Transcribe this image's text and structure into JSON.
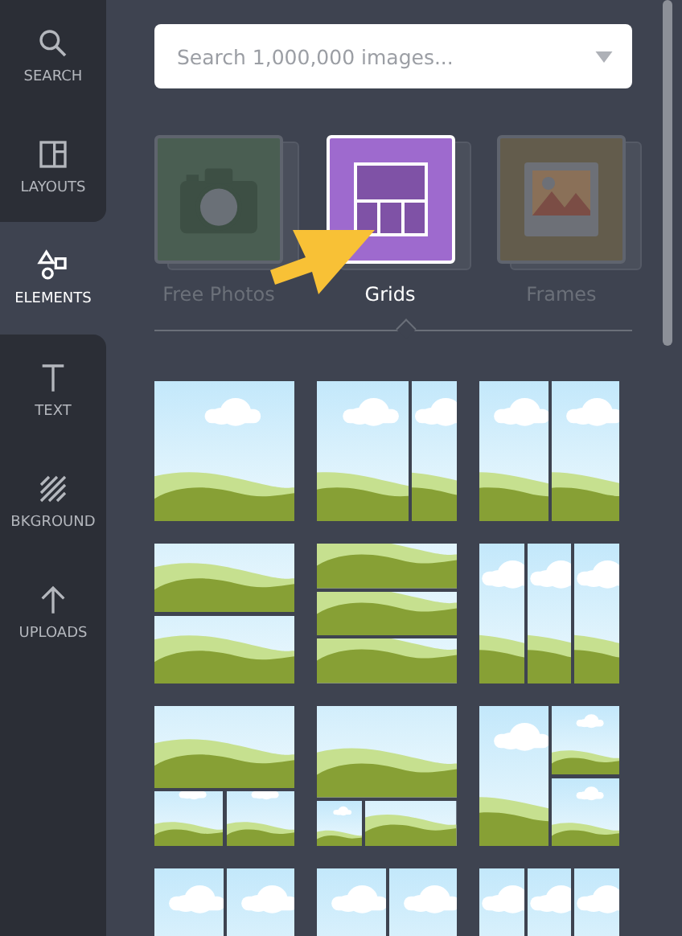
{
  "sidebar": {
    "items": [
      {
        "label": "SEARCH",
        "selected": false
      },
      {
        "label": "LAYOUTS",
        "selected": false
      },
      {
        "label": "ELEMENTS",
        "selected": true
      },
      {
        "label": "TEXT",
        "selected": false
      },
      {
        "label": "BKGROUND",
        "selected": false
      },
      {
        "label": "UPLOADS",
        "selected": false
      }
    ]
  },
  "search": {
    "placeholder": "Search 1,000,000 images..."
  },
  "categories": [
    {
      "label": "Free Photos",
      "color": "#4a5e52",
      "selected": false
    },
    {
      "label": "Grids",
      "color": "#9e6ace",
      "selected": true
    },
    {
      "label": "Frames",
      "color": "#635c4c",
      "selected": false
    }
  ],
  "grids": [
    {
      "kind": "single"
    },
    {
      "kind": "split"
    },
    {
      "kind": "halves"
    },
    {
      "kind": "rows"
    },
    {
      "kind": "strips"
    },
    {
      "kind": "columns"
    },
    {
      "kind": "tophalf"
    },
    {
      "kind": "topwide"
    },
    {
      "kind": "sidestack"
    },
    {
      "kind": "halves"
    },
    {
      "kind": "halves"
    },
    {
      "kind": "columns"
    }
  ]
}
